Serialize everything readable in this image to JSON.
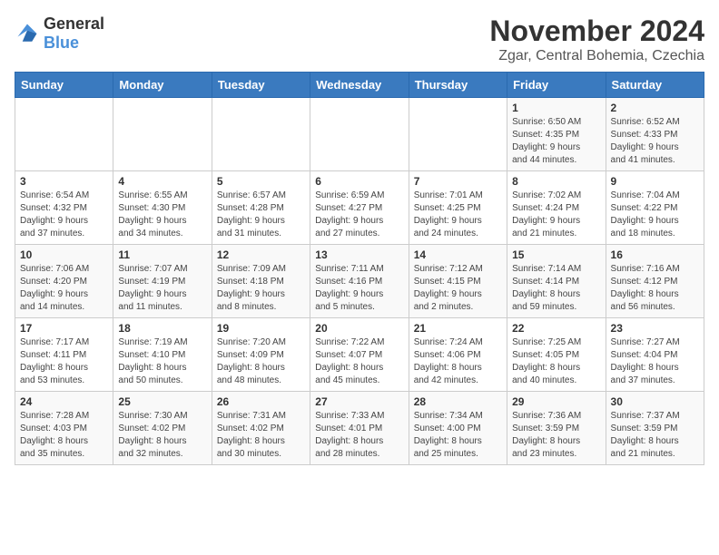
{
  "logo": {
    "general": "General",
    "blue": "Blue"
  },
  "title": "November 2024",
  "subtitle": "Zgar, Central Bohemia, Czechia",
  "weekdays": [
    "Sunday",
    "Monday",
    "Tuesday",
    "Wednesday",
    "Thursday",
    "Friday",
    "Saturday"
  ],
  "weeks": [
    [
      {
        "day": "",
        "info": ""
      },
      {
        "day": "",
        "info": ""
      },
      {
        "day": "",
        "info": ""
      },
      {
        "day": "",
        "info": ""
      },
      {
        "day": "",
        "info": ""
      },
      {
        "day": "1",
        "info": "Sunrise: 6:50 AM\nSunset: 4:35 PM\nDaylight: 9 hours\nand 44 minutes."
      },
      {
        "day": "2",
        "info": "Sunrise: 6:52 AM\nSunset: 4:33 PM\nDaylight: 9 hours\nand 41 minutes."
      }
    ],
    [
      {
        "day": "3",
        "info": "Sunrise: 6:54 AM\nSunset: 4:32 PM\nDaylight: 9 hours\nand 37 minutes."
      },
      {
        "day": "4",
        "info": "Sunrise: 6:55 AM\nSunset: 4:30 PM\nDaylight: 9 hours\nand 34 minutes."
      },
      {
        "day": "5",
        "info": "Sunrise: 6:57 AM\nSunset: 4:28 PM\nDaylight: 9 hours\nand 31 minutes."
      },
      {
        "day": "6",
        "info": "Sunrise: 6:59 AM\nSunset: 4:27 PM\nDaylight: 9 hours\nand 27 minutes."
      },
      {
        "day": "7",
        "info": "Sunrise: 7:01 AM\nSunset: 4:25 PM\nDaylight: 9 hours\nand 24 minutes."
      },
      {
        "day": "8",
        "info": "Sunrise: 7:02 AM\nSunset: 4:24 PM\nDaylight: 9 hours\nand 21 minutes."
      },
      {
        "day": "9",
        "info": "Sunrise: 7:04 AM\nSunset: 4:22 PM\nDaylight: 9 hours\nand 18 minutes."
      }
    ],
    [
      {
        "day": "10",
        "info": "Sunrise: 7:06 AM\nSunset: 4:20 PM\nDaylight: 9 hours\nand 14 minutes."
      },
      {
        "day": "11",
        "info": "Sunrise: 7:07 AM\nSunset: 4:19 PM\nDaylight: 9 hours\nand 11 minutes."
      },
      {
        "day": "12",
        "info": "Sunrise: 7:09 AM\nSunset: 4:18 PM\nDaylight: 9 hours\nand 8 minutes."
      },
      {
        "day": "13",
        "info": "Sunrise: 7:11 AM\nSunset: 4:16 PM\nDaylight: 9 hours\nand 5 minutes."
      },
      {
        "day": "14",
        "info": "Sunrise: 7:12 AM\nSunset: 4:15 PM\nDaylight: 9 hours\nand 2 minutes."
      },
      {
        "day": "15",
        "info": "Sunrise: 7:14 AM\nSunset: 4:14 PM\nDaylight: 8 hours\nand 59 minutes."
      },
      {
        "day": "16",
        "info": "Sunrise: 7:16 AM\nSunset: 4:12 PM\nDaylight: 8 hours\nand 56 minutes."
      }
    ],
    [
      {
        "day": "17",
        "info": "Sunrise: 7:17 AM\nSunset: 4:11 PM\nDaylight: 8 hours\nand 53 minutes."
      },
      {
        "day": "18",
        "info": "Sunrise: 7:19 AM\nSunset: 4:10 PM\nDaylight: 8 hours\nand 50 minutes."
      },
      {
        "day": "19",
        "info": "Sunrise: 7:20 AM\nSunset: 4:09 PM\nDaylight: 8 hours\nand 48 minutes."
      },
      {
        "day": "20",
        "info": "Sunrise: 7:22 AM\nSunset: 4:07 PM\nDaylight: 8 hours\nand 45 minutes."
      },
      {
        "day": "21",
        "info": "Sunrise: 7:24 AM\nSunset: 4:06 PM\nDaylight: 8 hours\nand 42 minutes."
      },
      {
        "day": "22",
        "info": "Sunrise: 7:25 AM\nSunset: 4:05 PM\nDaylight: 8 hours\nand 40 minutes."
      },
      {
        "day": "23",
        "info": "Sunrise: 7:27 AM\nSunset: 4:04 PM\nDaylight: 8 hours\nand 37 minutes."
      }
    ],
    [
      {
        "day": "24",
        "info": "Sunrise: 7:28 AM\nSunset: 4:03 PM\nDaylight: 8 hours\nand 35 minutes."
      },
      {
        "day": "25",
        "info": "Sunrise: 7:30 AM\nSunset: 4:02 PM\nDaylight: 8 hours\nand 32 minutes."
      },
      {
        "day": "26",
        "info": "Sunrise: 7:31 AM\nSunset: 4:02 PM\nDaylight: 8 hours\nand 30 minutes."
      },
      {
        "day": "27",
        "info": "Sunrise: 7:33 AM\nSunset: 4:01 PM\nDaylight: 8 hours\nand 28 minutes."
      },
      {
        "day": "28",
        "info": "Sunrise: 7:34 AM\nSunset: 4:00 PM\nDaylight: 8 hours\nand 25 minutes."
      },
      {
        "day": "29",
        "info": "Sunrise: 7:36 AM\nSunset: 3:59 PM\nDaylight: 8 hours\nand 23 minutes."
      },
      {
        "day": "30",
        "info": "Sunrise: 7:37 AM\nSunset: 3:59 PM\nDaylight: 8 hours\nand 21 minutes."
      }
    ]
  ]
}
